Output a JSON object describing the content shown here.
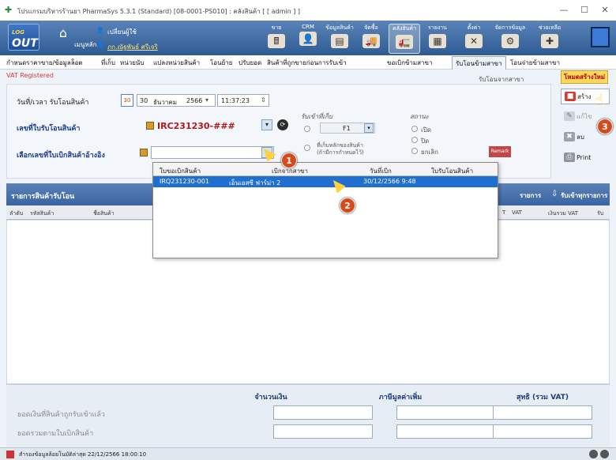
{
  "window": {
    "title": "โปรแกรมบริหารร้านยา PharmaSys 5.3.1 (Standard) [08-0001-PS010] : คลังสินค้า  [ [ admin ] ]",
    "min": "—",
    "max": "☐",
    "close": "✕"
  },
  "toolbar": {
    "logout": "OUT",
    "logout_small": "LOG",
    "home_label": "เมนูหลัก",
    "user_label": "เปลี่ยนผู้ใช้",
    "user_name": "ภก.ณัฐพันธ์ ศรีเจริ",
    "items": [
      {
        "label": "ขาย",
        "icon": "🖩"
      },
      {
        "label": "CRM",
        "icon": "👤"
      },
      {
        "label": "ข้อมูลสินค้า",
        "icon": "▤"
      },
      {
        "label": "จัดซื้อ",
        "icon": "🚚"
      },
      {
        "label": "คลังสินค้า",
        "icon": "🚛"
      },
      {
        "label": "รายงาน",
        "icon": "▦"
      },
      {
        "label": "ตั้งค่า",
        "icon": "✕"
      },
      {
        "label": "จัดการข้อมูล",
        "icon": "⚙"
      },
      {
        "label": "ช่วยเหลือ",
        "icon": "✚"
      }
    ]
  },
  "menu": [
    "กำหนดราคาขาย/ข้อมูลล็อต",
    "ที่เก็บ",
    "หน่วยนับ",
    "แปลงหน่วยสินค้า",
    "โอนย้าย",
    "ปรับยอด",
    "สินค้าที่ถูกขายก่อนการรับเข้า",
    "ขอเบิกข้ามสาขา",
    "รับโอนข้ามสาขา",
    "โอนจ่ายข้ามสาขา"
  ],
  "vat": "VAT Registered",
  "transfer_from": "รับโอนจากสาขา",
  "new_btn": "โหมดสร้างใหม่",
  "form": {
    "datetime_label": "วันที่/เวลา รับโอนสินค้า",
    "cal_day": "30",
    "date_day": "30",
    "date_month": "ธันวาคม",
    "date_year": "2566",
    "time": "11:37:23",
    "doc_label": "เลขที่ใบรับโอนสินค้า",
    "doc_value": "IRC231230-###",
    "ref_label": "เลือกเลขที่ใบเบิกสินค้าอ้างอิง",
    "store_title": "รับเข้าที่เก็บ",
    "store_value": "F1",
    "store_note1": "ที่เก็บหลักของสินค้า",
    "store_note2": "(ถ้ามีการกำหนดไว้)",
    "status_title": "สถานะ",
    "status_open": "เปิด",
    "status_close": "ปิด",
    "status_cancel": "ยกเลิก",
    "remark": "Remark"
  },
  "side_buttons": {
    "create": "สร้าง",
    "edit": "แก้ไข",
    "delete": "ลบ",
    "print": "Print"
  },
  "list": {
    "title": "รายการสินค้ารับโอน",
    "btn1": "รายการ",
    "btn2": "รับเข้าทุกรายการ",
    "columns": [
      "ลำดับ",
      "รหัสสินค้า",
      "ชื่อสินค้า",
      "T",
      "VAT",
      "เงินรวม VAT",
      "รับ"
    ]
  },
  "totals": {
    "h_amount": "จำนวนเงิน",
    "h_vat": "ภาษีมูลค่าเพิ่ม",
    "h_net": "สุทธิ (รวม VAT)",
    "row1": "ยอดเงินที่สินค้าถูกรับเข้าแล้ว",
    "row2": "ยอดรวมตามใบเบิกสินค้า"
  },
  "status": {
    "text": "สำรองข้อมูลล้อยโนมัติล่าสุด  22/12/2566 18:00:10"
  },
  "dropdown": {
    "headers": [
      "ใบขอเบิกสินค้า",
      "เบิกจากสาขา",
      "วันที่เบิก",
      "ใบรับโอนสินค้า"
    ],
    "rows": [
      [
        "IRQ231230-001",
        "เอ็นเอสซี ฟาร์ม่า 2",
        "30/12/2566 9:48",
        ""
      ]
    ]
  },
  "badges": [
    "1",
    "2",
    "3"
  ]
}
